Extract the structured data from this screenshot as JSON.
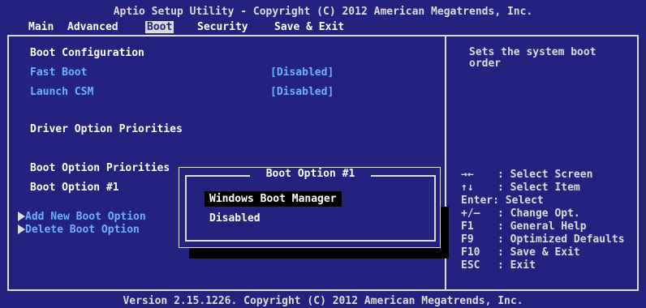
{
  "header": {
    "title": "Aptio Setup Utility - Copyright (C) 2012 American Megatrends, Inc.",
    "menu": [
      "Main",
      "Advanced",
      "Boot",
      "Security",
      "Save & Exit"
    ],
    "active_menu": "Boot"
  },
  "boot": {
    "config_heading": "Boot Configuration",
    "fast_boot_label": "Fast Boot",
    "fast_boot_value": "[Disabled]",
    "launch_csm_label": "Launch CSM",
    "launch_csm_value": "[Disabled]",
    "driver_heading": "Driver Option Priorities",
    "boot_heading": "Boot Option Priorities",
    "boot_option1_label": "Boot Option #1",
    "add_label": "Add New Boot Option",
    "delete_label": "Delete Boot Option"
  },
  "help": {
    "line1": "Sets the system boot",
    "line2": "order",
    "keys": [
      {
        "key": "→←",
        "desc": ": Select Screen"
      },
      {
        "key": "↑↓",
        "desc": ": Select Item"
      },
      {
        "key": "Enter",
        "desc": ": Select"
      },
      {
        "key": "+/—",
        "desc": ": Change Opt."
      },
      {
        "key": "F1",
        "desc": ": General Help"
      },
      {
        "key": "F9",
        "desc": ": Optimized Defaults"
      },
      {
        "key": "F10",
        "desc": ": Save & Exit"
      },
      {
        "key": "ESC",
        "desc": ": Exit"
      }
    ]
  },
  "popup": {
    "title": "Boot Option #1",
    "options": [
      "Windows Boot Manager",
      "Disabled"
    ],
    "selected": "Windows Boot Manager"
  },
  "footer": {
    "version": "Version 2.15.1226. Copyright (C) 2012 American Megatrends, Inc."
  },
  "colors": {
    "background": "#23227f",
    "text": "#dcdcdc",
    "highlight": "#ffffff",
    "link": "#6fb0ff",
    "shadow": "#000000"
  }
}
